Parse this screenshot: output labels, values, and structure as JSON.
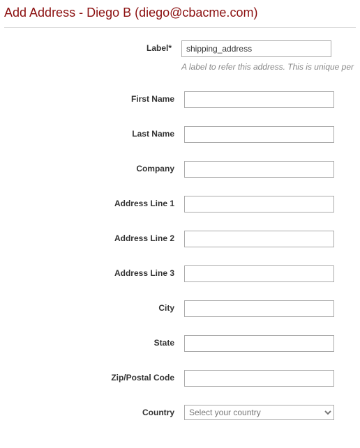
{
  "heading": "Add Address - Diego B (diego@cbacme.com)",
  "fields": {
    "label": {
      "label": "Label*",
      "value": "shipping_address",
      "hint": "A label to refer this address. This is unique per subscription."
    },
    "first_name": {
      "label": "First Name",
      "value": ""
    },
    "last_name": {
      "label": "Last Name",
      "value": ""
    },
    "company": {
      "label": "Company",
      "value": ""
    },
    "address_line_1": {
      "label": "Address Line 1",
      "value": ""
    },
    "address_line_2": {
      "label": "Address Line 2",
      "value": ""
    },
    "address_line_3": {
      "label": "Address Line 3",
      "value": ""
    },
    "city": {
      "label": "City",
      "value": ""
    },
    "state": {
      "label": "State",
      "value": ""
    },
    "zip": {
      "label": "Zip/Postal Code",
      "value": ""
    },
    "country": {
      "label": "Country",
      "placeholder": "Select your country",
      "value": ""
    }
  }
}
